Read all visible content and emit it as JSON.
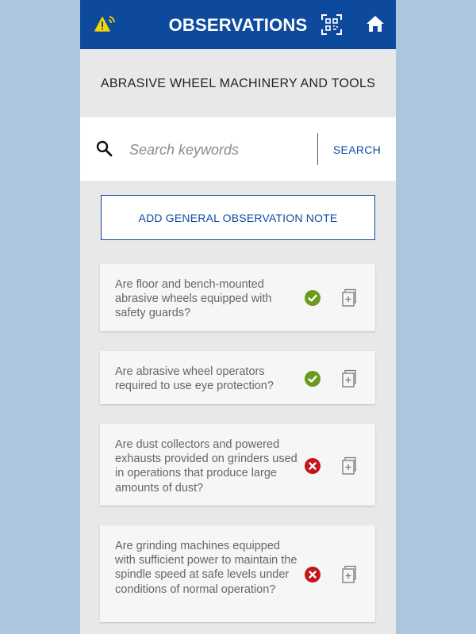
{
  "header": {
    "title": "OBSERVATIONS",
    "icons": [
      "warning-signal-icon",
      "qr-scan-icon",
      "home-icon"
    ]
  },
  "subtitle": "ABRASIVE WHEEL MACHINERY AND TOOLS",
  "search": {
    "placeholder": "Search keywords",
    "value": "",
    "button_label": "SEARCH"
  },
  "add_note_label": "ADD GENERAL OBSERVATION NOTE",
  "colors": {
    "primary": "#0d4a9e",
    "check": "#6a9a1f",
    "fail": "#c4161c",
    "page_bg": "#adc6de"
  },
  "observations": [
    {
      "question": "Are floor and bench-mounted abrasive wheels equipped with safety guards?",
      "status": "compliant"
    },
    {
      "question": "Are abrasive wheel operators required to use eye protection?",
      "status": "compliant"
    },
    {
      "question": "Are dust collectors and powered exhausts provided on grinders used in operations that produce large amounts of dust?",
      "status": "non-compliant"
    },
    {
      "question": "Are grinding machines equipped with sufficient power to maintain the spindle speed at safe levels under conditions of normal operation?",
      "status": "non-compliant"
    }
  ]
}
